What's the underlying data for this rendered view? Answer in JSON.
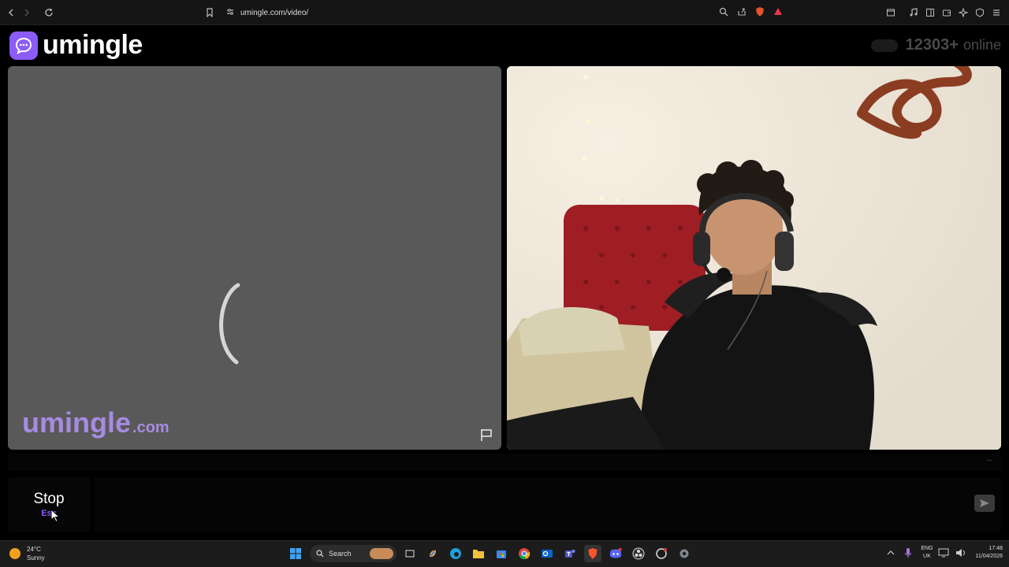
{
  "browser": {
    "url": "umingle.com/video/"
  },
  "header": {
    "logo_text": "umingle",
    "online_count": "12303+",
    "online_label": "online"
  },
  "left_panel": {
    "watermark_main": "umingle",
    "watermark_tld": ".com"
  },
  "controls": {
    "stop_label": "Stop",
    "stop_hint": "Esc",
    "chat_placeholder": ""
  },
  "taskbar": {
    "temperature": "24°C",
    "weather": "Sunny",
    "search_label": "Search",
    "lang_top": "ENG",
    "lang_bottom": "UK",
    "time": "17:48",
    "date": "11/04/2026"
  },
  "colors": {
    "brand": "#8b5cf6",
    "watermark": "#a58ce0",
    "panel_gray": "#595959"
  }
}
